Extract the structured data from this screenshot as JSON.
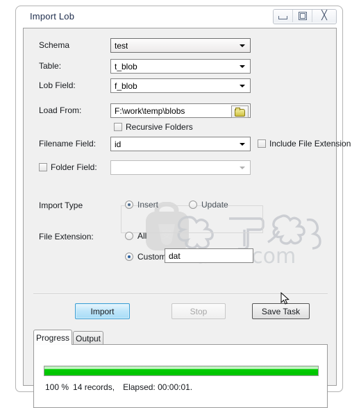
{
  "window": {
    "title": "Import Lob",
    "buttons": {
      "minimize": "minimize",
      "maximize": "maximize",
      "close": "close"
    }
  },
  "form": {
    "schema": {
      "label": "Schema",
      "value": "test"
    },
    "table": {
      "label": "Table:",
      "value": "t_blob"
    },
    "lob_field": {
      "label": "Lob Field:",
      "value": "f_blob"
    },
    "load_from": {
      "label": "Load From:",
      "value": "F:\\work\\temp\\blobs"
    },
    "recursive_folders": {
      "label": "Recursive Folders",
      "checked": false
    },
    "filename_field": {
      "label": "Filename Field:",
      "value": "id"
    },
    "include_file_extension": {
      "label": "Include File Extension",
      "checked": false
    },
    "folder_field": {
      "label": "Folder Field:",
      "checked": false,
      "value": ""
    },
    "import_type": {
      "label": "Import Type",
      "options": [
        "Insert",
        "Update"
      ],
      "selected": "Insert"
    },
    "file_extension": {
      "label": "File Extension:",
      "options": [
        "All",
        "Custom"
      ],
      "selected": "Custom",
      "custom_value": "dat"
    }
  },
  "actions": {
    "import": "Import",
    "stop": "Stop",
    "save_task": "Save Task"
  },
  "tabs": [
    {
      "label": "Progress",
      "active": true
    },
    {
      "label": "Output",
      "active": false
    }
  ],
  "progress": {
    "percent": 100,
    "percent_text": "100 %",
    "records_text": "14 records,",
    "elapsed_text": "Elapsed: 00:00:01.",
    "bar_color": "#00c400"
  },
  "watermark": {
    "site": "anxz.com",
    "cjk": "安下载"
  }
}
